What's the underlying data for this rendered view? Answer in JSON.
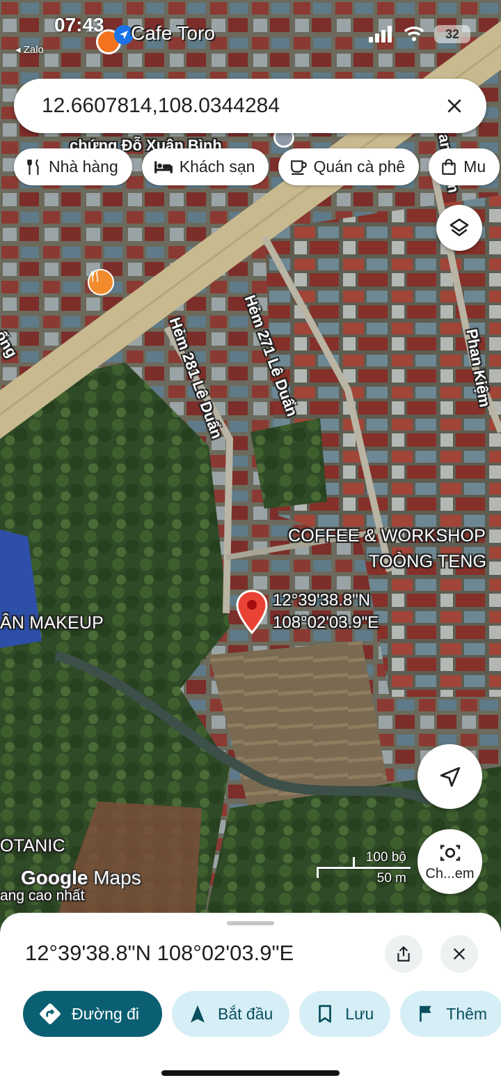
{
  "status_bar": {
    "time": "07:43",
    "back_app": "◂ Zalo",
    "battery": "32"
  },
  "search": {
    "query": "12.6607814,108.0344284"
  },
  "chips": [
    {
      "label": "Nhà hàng",
      "icon": "restaurant-icon"
    },
    {
      "label": "Khách sạn",
      "icon": "hotel-icon"
    },
    {
      "label": "Quán cà phê",
      "icon": "coffee-icon"
    },
    {
      "label": "Mu",
      "icon": "shopping-bag-icon"
    }
  ],
  "map_labels": {
    "cafe_toro": "Cafe Toro",
    "xuan_binh": "chứng Đỗ Xuân Bình",
    "hem_271": "Hẻm 271 Lê Duẩn",
    "hem_281": "Hẻm 281 Lê Duẩn",
    "phan_kiem": "Phan Kiệm",
    "phan_kiem_top": "an Kiệm",
    "ong": "ống",
    "coffee_workshop_1": "COFFEE & WORKSHOP",
    "coffee_workshop_2": "TOÒNG TENG",
    "makeup": "ÂN MAKEUP",
    "botanic": "OTANIC",
    "cao_nhat": "ang cao nhất"
  },
  "pin": {
    "lat": "12°39'38.8\"N",
    "lng": "108°02'03.9\"E",
    "color": "#ea4335"
  },
  "controls": {
    "lens_label": "Ch...em"
  },
  "logo": {
    "google": "Google",
    "maps": "Maps"
  },
  "scale": {
    "imperial": "100 bộ",
    "metric": "50 m"
  },
  "sheet": {
    "title": "12°39'38.8\"N 108°02'03.9\"E",
    "actions": [
      {
        "label": "Đường đi",
        "icon": "directions-icon"
      },
      {
        "label": "Bắt đầu",
        "icon": "navigation-icon"
      },
      {
        "label": "Lưu",
        "icon": "bookmark-icon"
      },
      {
        "label": "Thêm",
        "icon": "flag-icon"
      }
    ]
  },
  "colors": {
    "primary_button": "#0b5f72",
    "secondary_button": "#d6eef6",
    "pin_red": "#ea4335"
  }
}
